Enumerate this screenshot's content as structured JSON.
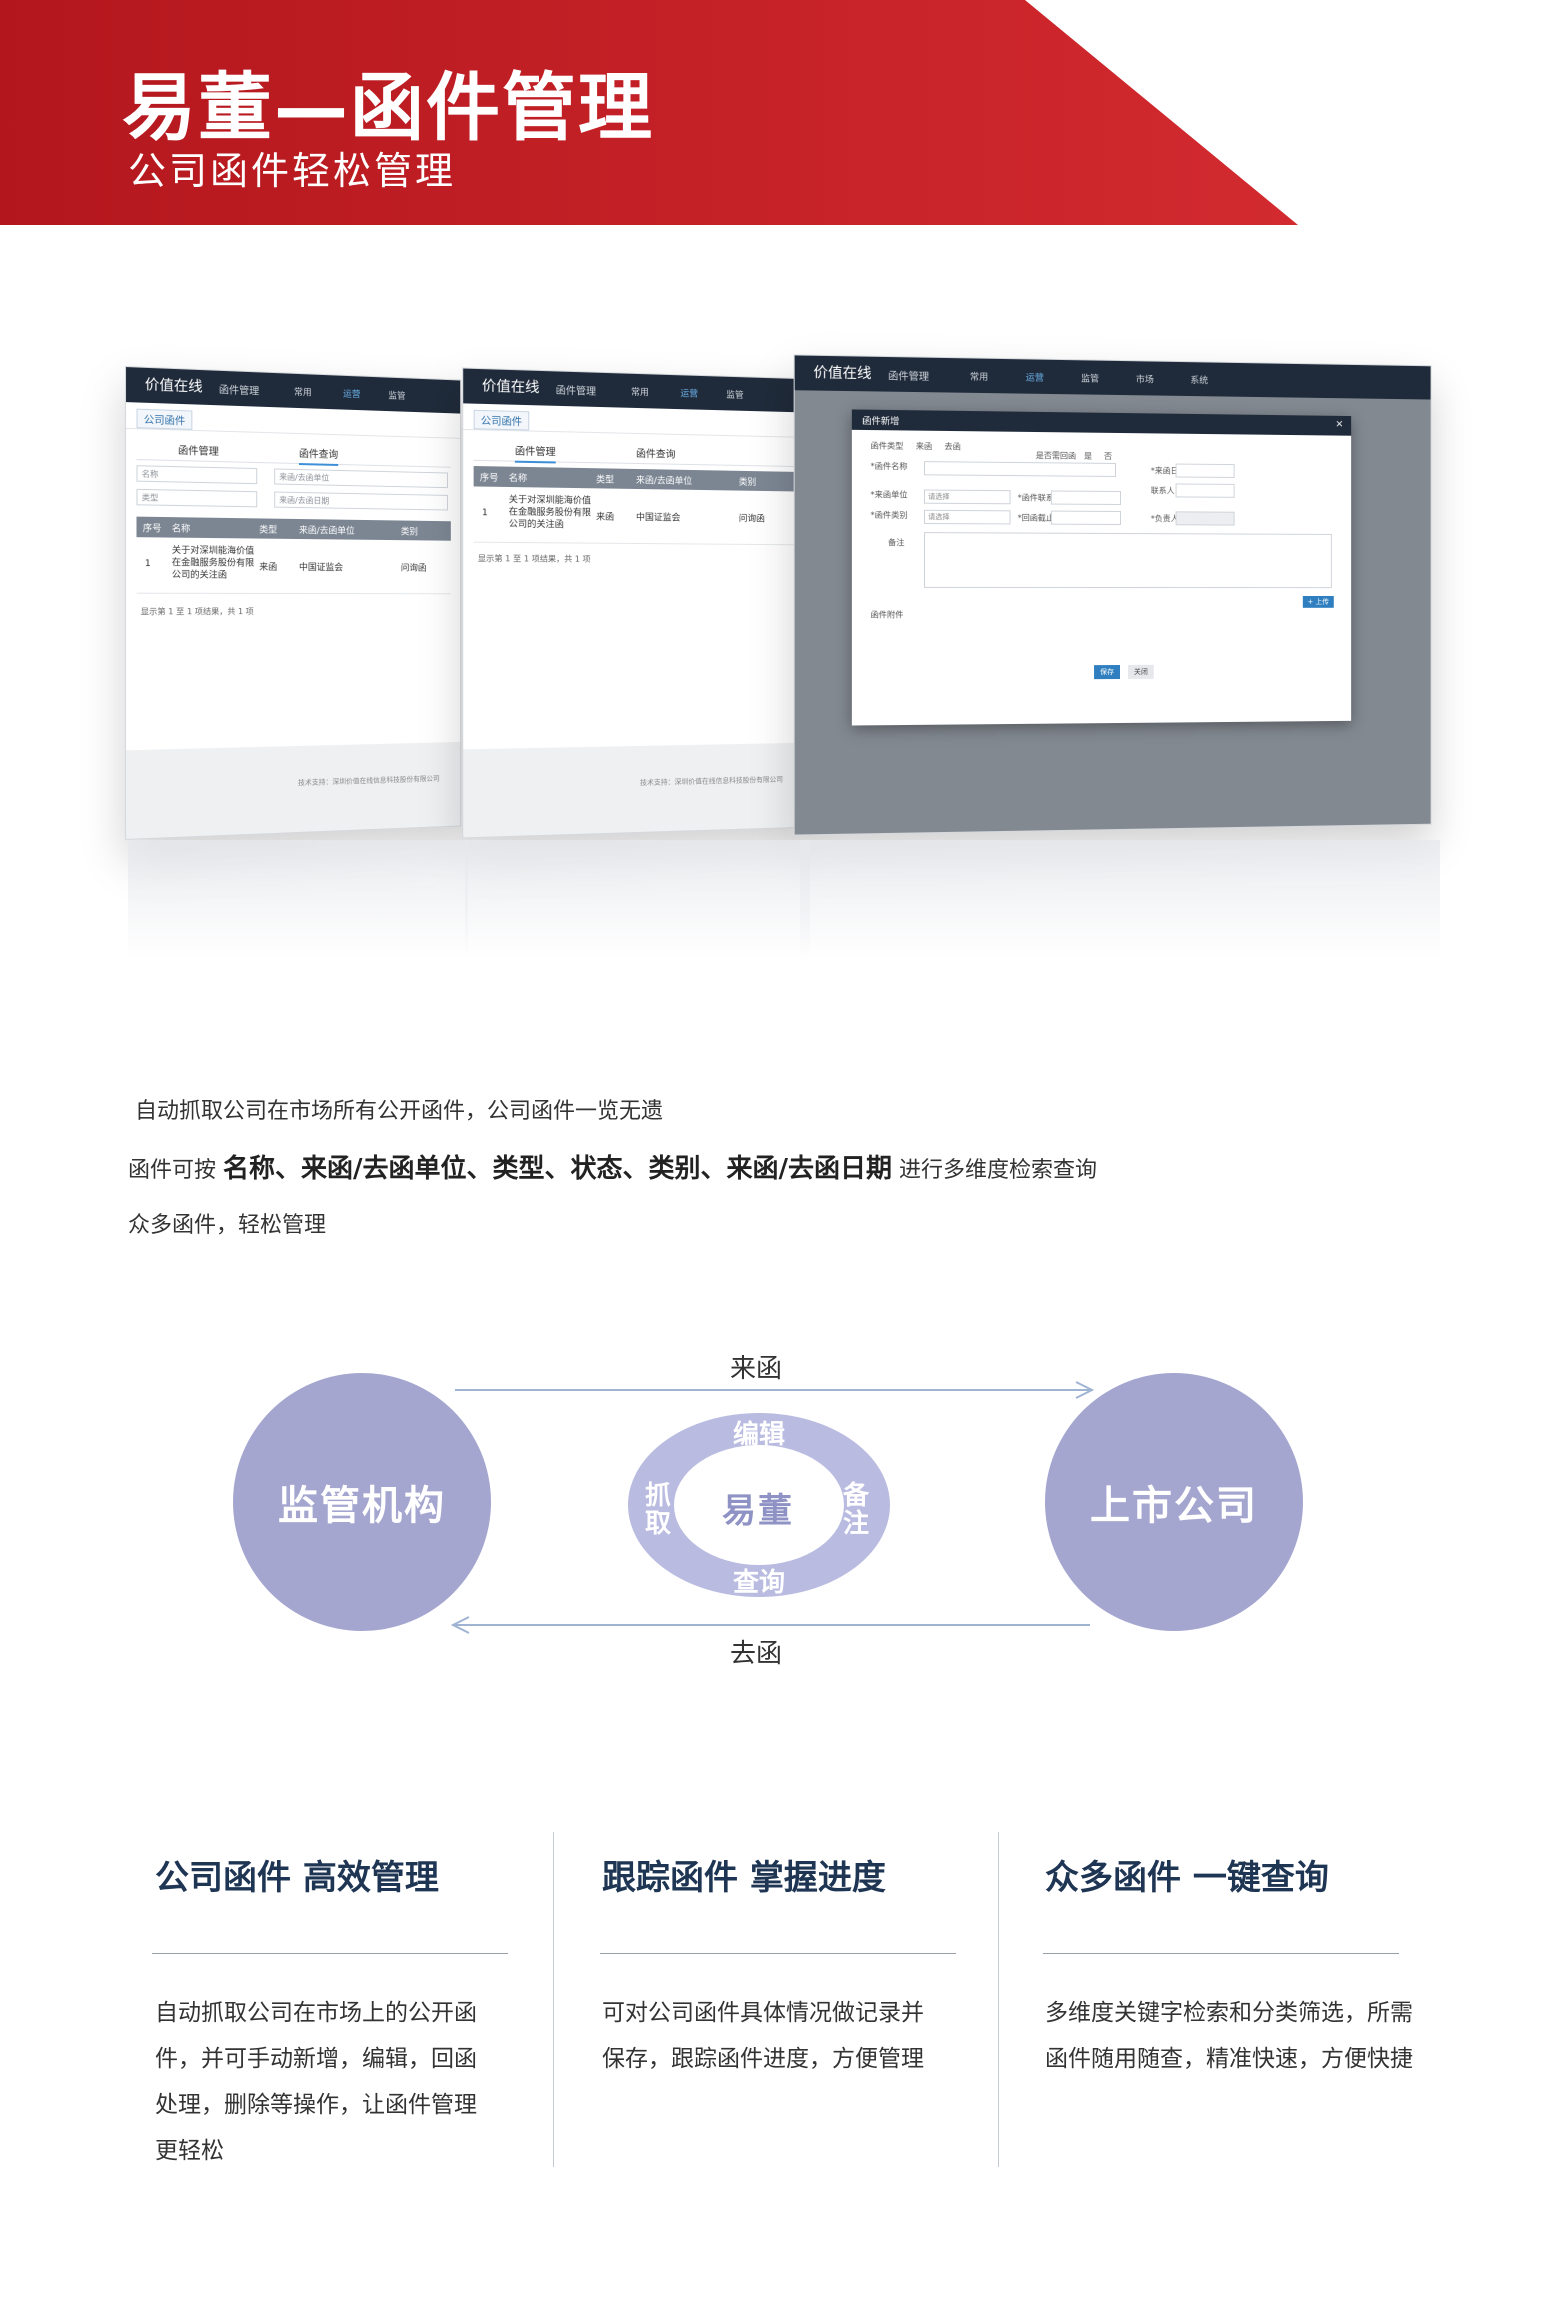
{
  "banner": {
    "title": "易董—函件管理",
    "subtitle": "公司函件轻松管理",
    "color": "#c21f25"
  },
  "screens": {
    "list1": {
      "logo": "价值在线",
      "module": "函件管理",
      "nav": [
        "常用",
        "运营",
        "监管"
      ],
      "crumb": "公司函件",
      "tabs": [
        "函件管理",
        "函件查询"
      ],
      "filters": [
        "名称",
        "来函/去函单位",
        "类型",
        "来函/去函日期"
      ],
      "headers": [
        "序号",
        "名称",
        "类型",
        "来函/去函单位",
        "类别"
      ],
      "row": [
        "1",
        "关于对深圳能海价值在金融服务股份有限公司的关注函",
        "来函",
        "中国证监会",
        "问询函"
      ],
      "footer": "显示第 1 至 1 项结果，共 1 项",
      "tech": "技术支持：深圳价值在线信息科技股份有限公司"
    },
    "list2": {
      "logo": "价值在线",
      "module": "函件管理",
      "nav": [
        "常用",
        "运营",
        "监管"
      ],
      "crumb": "公司函件",
      "tabs": [
        "函件管理",
        "函件查询"
      ],
      "headers": [
        "序号",
        "名称",
        "类型",
        "来函/去函单位",
        "类别"
      ],
      "row": [
        "1",
        "关于对深圳能海价值在金融服务股份有限公司的关注函",
        "来函",
        "中国证监会",
        "问询函"
      ],
      "footer": "显示第 1 至 1 项结果，共 1 项",
      "tech": "技术支持：深圳价值在线信息科技股份有限公司"
    },
    "modal": {
      "logo": "价值在线",
      "module": "函件管理",
      "nav": [
        "常用",
        "运营",
        "监管",
        "市场",
        "系统"
      ],
      "title": "函件新增",
      "close": "×",
      "type_label": "函件类型",
      "type_opt1": "来函",
      "type_opt2": "去函",
      "reply_label": "是否需回函",
      "reply_opt1": "是",
      "reply_opt2": "否",
      "name_label": "*函件名称",
      "unit_label": "*来函单位",
      "category_label": "*函件类别",
      "select_placeholder": "请选择",
      "contact_label": "*函件联系人",
      "deadline_label": "*回函截止日期",
      "date_label": "*来函日期",
      "handler_label": "联系人电话",
      "owner_label": "*负责人",
      "remark_label": "备注",
      "attach_label": "函件附件",
      "add_label": "+ 上传",
      "save_label": "保存",
      "close_label": "关闭"
    }
  },
  "description": {
    "line1": "自动抓取公司在市场所有公开函件，公司函件一览无遗",
    "line2_prefix": "函件可按",
    "line2_bold": "名称、来函/去函单位、类型、状态、类别、来函/去函日期",
    "line2_suffix": "进行多维度检索查询",
    "line3": "众多函件，轻松管理"
  },
  "diagram": {
    "left": "监管机构",
    "right": "上市公司",
    "center": "易董",
    "ring_top": "编辑",
    "ring_bottom": "查询",
    "ring_left": "抓取",
    "ring_right": "备注",
    "arrow_top": "来函",
    "arrow_bottom": "去函",
    "circle_color": "#a4a6cf"
  },
  "columns": [
    {
      "title": "公司函件  高效管理",
      "lines": [
        "自动抓取公司在市场上的公开函",
        "件，并可手动新增，编辑，回函",
        "处理，删除等操作，让函件管理",
        "更轻松"
      ]
    },
    {
      "title": "跟踪函件  掌握进度",
      "lines": [
        "可对公司函件具体情况做记录并",
        "保存，跟踪函件进度，方便管理"
      ]
    },
    {
      "title": "众多函件  一键查询",
      "lines": [
        "多维度关键字检索和分类筛选，所需",
        "函件随用随查，精准快速，方便快捷"
      ]
    }
  ]
}
